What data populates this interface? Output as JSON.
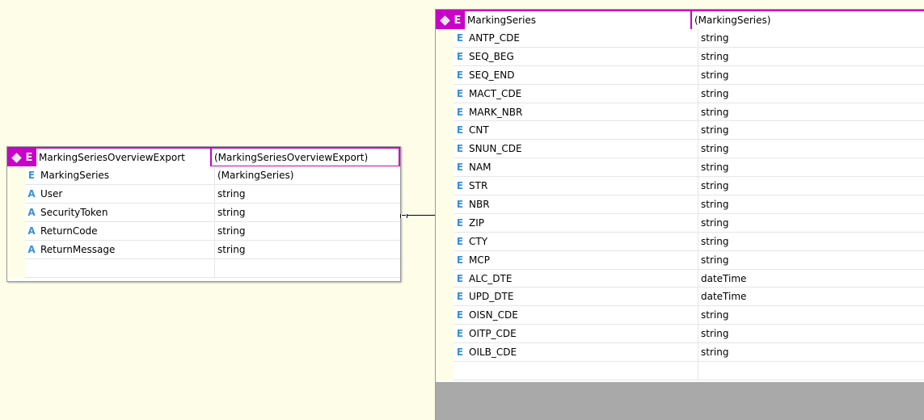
{
  "left_entity": {
    "kind_icon": "E",
    "name": "MarkingSeriesOverviewExport",
    "type": "(MarkingSeriesOverviewExport)",
    "rows": [
      {
        "kind": "E",
        "name": "MarkingSeries",
        "type": "(MarkingSeries)"
      },
      {
        "kind": "A",
        "name": "User",
        "type": "string"
      },
      {
        "kind": "A",
        "name": "SecurityToken",
        "type": "string"
      },
      {
        "kind": "A",
        "name": "ReturnCode",
        "type": "string"
      },
      {
        "kind": "A",
        "name": "ReturnMessage",
        "type": "string"
      }
    ]
  },
  "right_entity": {
    "kind_icon": "E",
    "name": "MarkingSeries",
    "type": "(MarkingSeries)",
    "rows": [
      {
        "kind": "E",
        "name": "ANTP_CDE",
        "type": "string"
      },
      {
        "kind": "E",
        "name": "SEQ_BEG",
        "type": "string"
      },
      {
        "kind": "E",
        "name": "SEQ_END",
        "type": "string"
      },
      {
        "kind": "E",
        "name": "MACT_CDE",
        "type": "string"
      },
      {
        "kind": "E",
        "name": "MARK_NBR",
        "type": "string"
      },
      {
        "kind": "E",
        "name": "CNT",
        "type": "string"
      },
      {
        "kind": "E",
        "name": "SNUN_CDE",
        "type": "string"
      },
      {
        "kind": "E",
        "name": "NAM",
        "type": "string"
      },
      {
        "kind": "E",
        "name": "STR",
        "type": "string"
      },
      {
        "kind": "E",
        "name": "NBR",
        "type": "string"
      },
      {
        "kind": "E",
        "name": "ZIP",
        "type": "string"
      },
      {
        "kind": "E",
        "name": "CTY",
        "type": "string"
      },
      {
        "kind": "E",
        "name": "MCP",
        "type": "string"
      },
      {
        "kind": "E",
        "name": "ALC_DTE",
        "type": "dateTime"
      },
      {
        "kind": "E",
        "name": "UPD_DTE",
        "type": "dateTime"
      },
      {
        "kind": "E",
        "name": "OISN_CDE",
        "type": "string"
      },
      {
        "kind": "E",
        "name": "OITP_CDE",
        "type": "string"
      },
      {
        "kind": "E",
        "name": "OILB_CDE",
        "type": "string"
      }
    ]
  },
  "colors": {
    "background": "#fefee8",
    "header_accent": "#c800c8",
    "element_icon": "#3a8fd8",
    "footer": "#a9a9a9"
  },
  "icons": {
    "header_marker": "diamond-icon",
    "collapse_marker": "collapse-box-icon"
  }
}
